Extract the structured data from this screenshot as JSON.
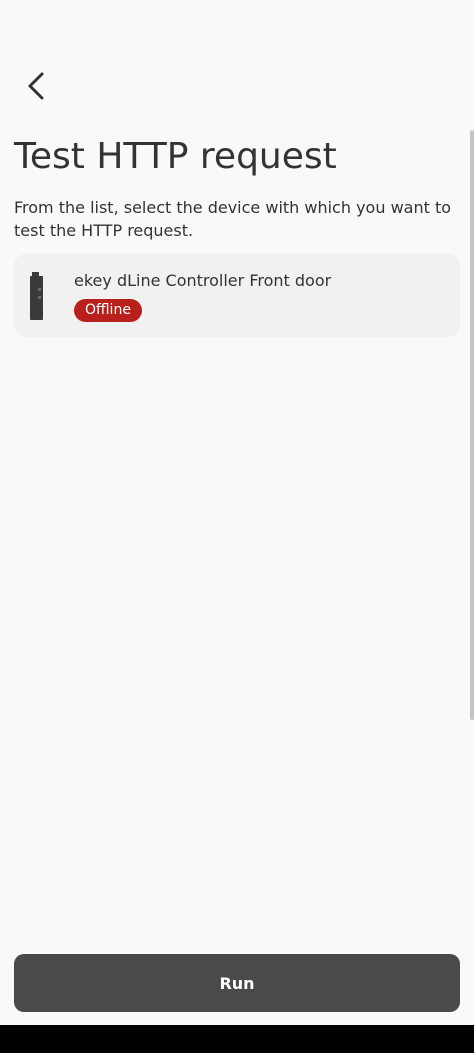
{
  "header": {
    "back_icon": "chevron-left-icon",
    "title": "Test HTTP request",
    "description": "From the list, select the device with which you want to test the HTTP request."
  },
  "devices": [
    {
      "name": "ekey dLine Controller Front door",
      "icon": "controller-device-icon",
      "status": "Offline",
      "status_color": "#b8201c"
    }
  ],
  "footer": {
    "run_label": "Run"
  },
  "colors": {
    "background": "#f9f9f9",
    "card": "#f1f1f1",
    "text": "#333333",
    "button": "#4a4a4a",
    "offline": "#b8201c"
  }
}
